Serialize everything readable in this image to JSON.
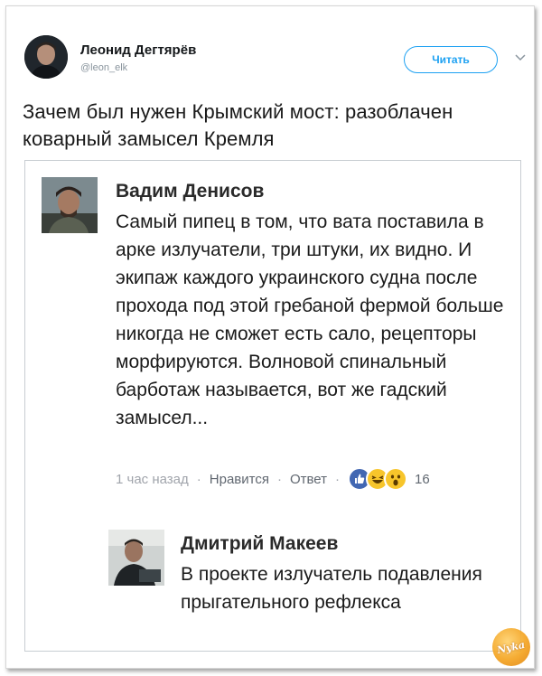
{
  "tweet": {
    "author_name": "Леонид Дегтярёв",
    "author_handle": "@leon_elk",
    "follow_label": "Читать",
    "text": "Зачем был нужен Крымский мост: разоблачен коварный замысел Кремля"
  },
  "embedded_post": {
    "comment": {
      "author": "Вадим Денисов",
      "text": "Самый пипец в том, что вата поставила в арке излучатели, три штуки, их видно. И экипаж каждого украинского судна после прохода под этой гребаной фермой больше никогда не сможет есть сало, рецепторы морфируются. Волновой спинальный барботаж называется, вот же гадский замысел...",
      "time": "1 час назад",
      "like_label": "Нравится",
      "reply_label": "Ответ",
      "separator": "·",
      "reaction_count": "16",
      "reactions": [
        "like-icon",
        "laugh-icon",
        "wow-icon"
      ]
    },
    "reply": {
      "author": "Дмитрий Макеев",
      "text": "В проекте излучатель подавления прыгательного рефлекса"
    }
  },
  "watermark": {
    "label": "Nyka"
  },
  "colors": {
    "twitter_blue": "#1da1f2",
    "facebook_blue": "#4267b2",
    "reaction_yellow": "#f7c52b",
    "watermark_orange": "#f4a21c"
  }
}
